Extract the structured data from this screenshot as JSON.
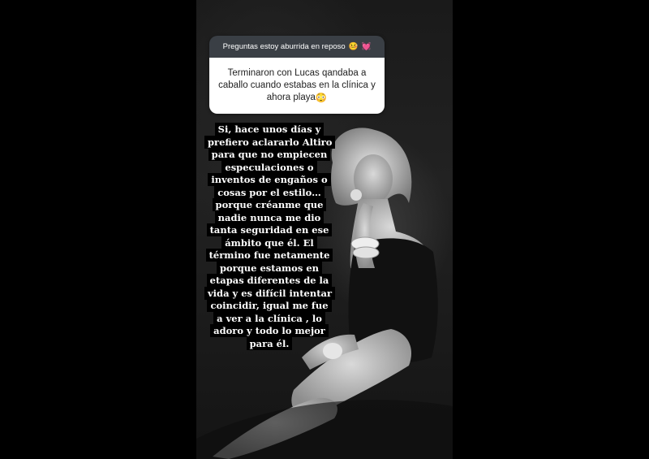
{
  "question_box": {
    "header": "Preguntas estoy aburrida en reposo",
    "header_emojis": [
      "🤒",
      "💓"
    ],
    "question": "Terminaron con Lucas qandaba a caballo cuando estabas en la clínica y ahora playa",
    "question_emoji": "😳"
  },
  "answer_text": "Si, hace unos días y prefiero aclararlo Altiro para que no empiecen especulaciones o inventos de engaños o cosas por el estilo… porque créanme que nadie nunca me dio tanta seguridad en ese ámbito que él. El término fue netamente porque estamos en etapas diferentes de la vida y es difícil intentar coincidir, igual me fue a ver a la clínica , lo adoro y todo lo mejor para él.",
  "colors": {
    "page_background": "#000000",
    "question_header": "#3a3f45",
    "question_body": "#ffffff",
    "answer_highlight": "#000000"
  }
}
